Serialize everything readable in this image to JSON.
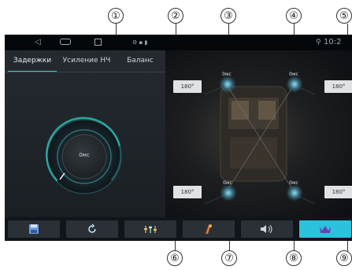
{
  "callouts": [
    "①",
    "②",
    "③",
    "④",
    "⑤",
    "⑥",
    "⑦",
    "⑧",
    "⑨"
  ],
  "status_bar": {
    "clock": "10:2"
  },
  "tabs": [
    {
      "label": "Задержки",
      "active": true
    },
    {
      "label": "Усиление НЧ",
      "active": false
    },
    {
      "label": "Баланс",
      "active": false
    }
  ],
  "dial": {
    "value": "0мс"
  },
  "delays": {
    "front_left": "180°",
    "front_right": "180°",
    "rear_left": "180°",
    "rear_right": "180°"
  },
  "speakers": {
    "front_left": "0мс",
    "front_right": "0мс",
    "rear_left": "0мс",
    "rear_right": "0мс"
  },
  "bottom_nav": [
    "save",
    "reset",
    "eq",
    "sound-effect",
    "volume",
    "crown"
  ],
  "colors": {
    "accent": "#2bc2dc",
    "tab_underline": "#3fd0c0"
  }
}
